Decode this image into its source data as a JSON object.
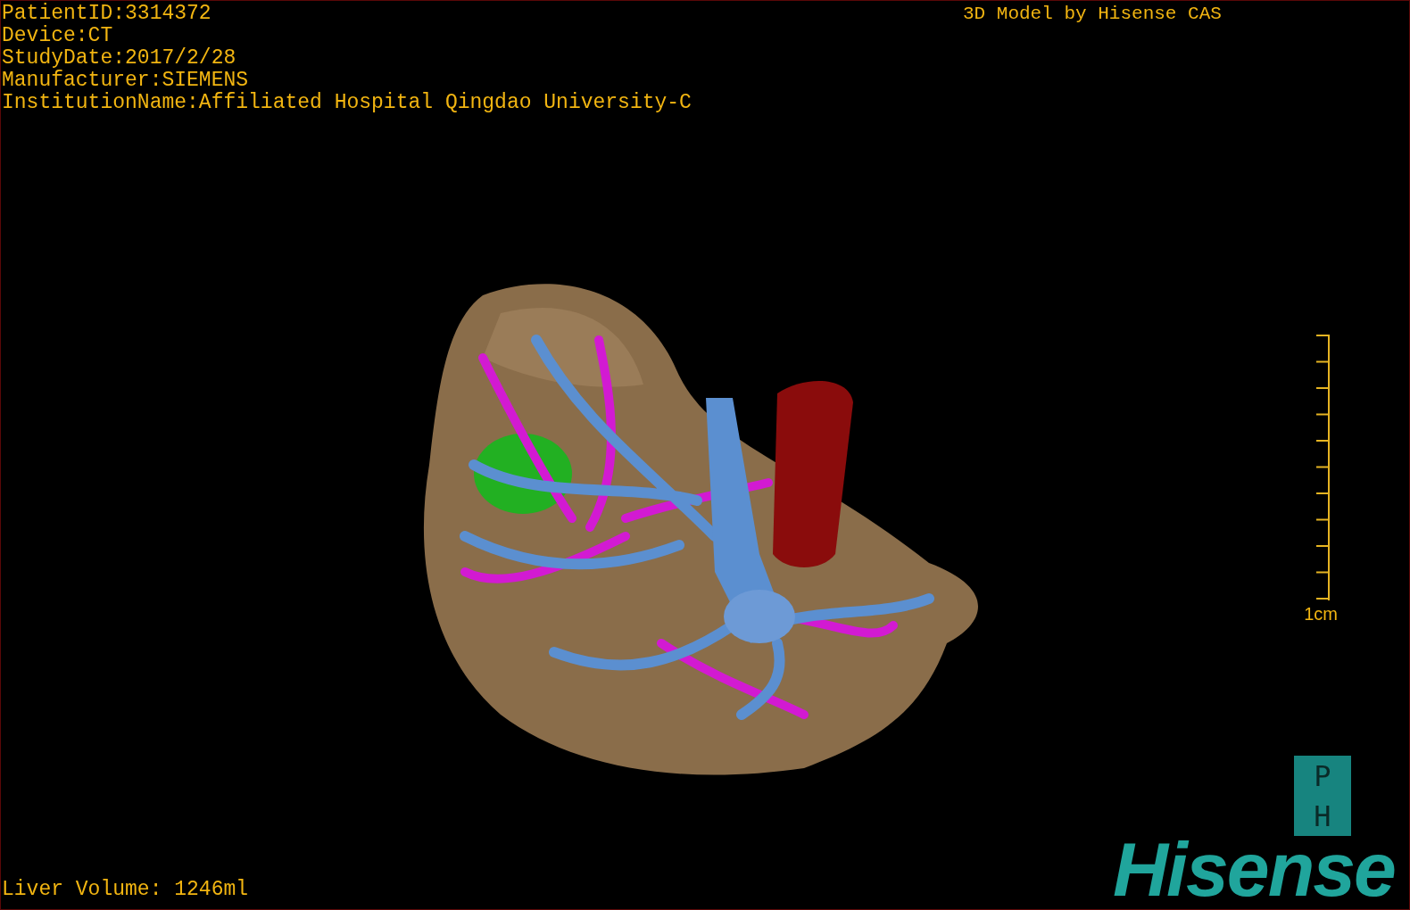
{
  "patient_info": [
    "PatientID:3314372",
    "Device:CT",
    "StudyDate:2017/2/28",
    "Manufacturer:SIEMENS",
    "InstitutionName:Affiliated Hospital Qingdao University-C"
  ],
  "model_title": "3D Model by Hisense CAS",
  "scale_bar": {
    "label": "1cm"
  },
  "logo": {
    "letters": [
      "P",
      "H"
    ],
    "wordmark": "Hisense"
  },
  "liver_volume": "Liver Volume: 1246ml"
}
